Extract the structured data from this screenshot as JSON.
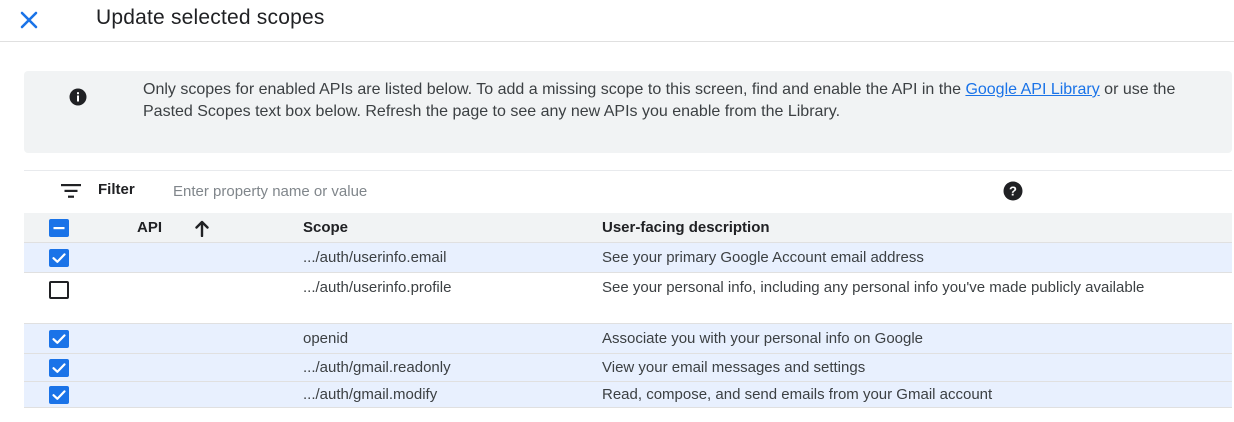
{
  "header": {
    "title": "Update selected scopes",
    "close_icon": "close-icon"
  },
  "info": {
    "text_before": "Only scopes for enabled APIs are listed below. To add a missing scope to this screen, find and enable the API in the ",
    "link_text": "Google API Library",
    "text_after": " or use the Pasted Scopes text box below. Refresh the page to see any new APIs you enable from the Library."
  },
  "filter": {
    "label": "Filter",
    "placeholder": "Enter property name or value"
  },
  "table": {
    "columns": {
      "api": "API",
      "scope": "Scope",
      "description": "User-facing description"
    },
    "rows": [
      {
        "checked": true,
        "scope": ".../auth/userinfo.email",
        "description": "See your primary Google Account email address"
      },
      {
        "checked": false,
        "scope": ".../auth/userinfo.profile",
        "description": "See your personal info, including any personal info you've made publicly available"
      },
      {
        "checked": true,
        "scope": "openid",
        "description": "Associate you with your personal info on Google"
      },
      {
        "checked": true,
        "scope": ".../auth/gmail.readonly",
        "description": "View your email messages and settings"
      },
      {
        "checked": true,
        "scope": ".../auth/gmail.modify",
        "description": "Read, compose, and send emails from your Gmail account"
      }
    ]
  },
  "colors": {
    "accent": "#1a73e8",
    "selected_row": "#e8f0fe",
    "info_bg": "#f1f3f4"
  }
}
